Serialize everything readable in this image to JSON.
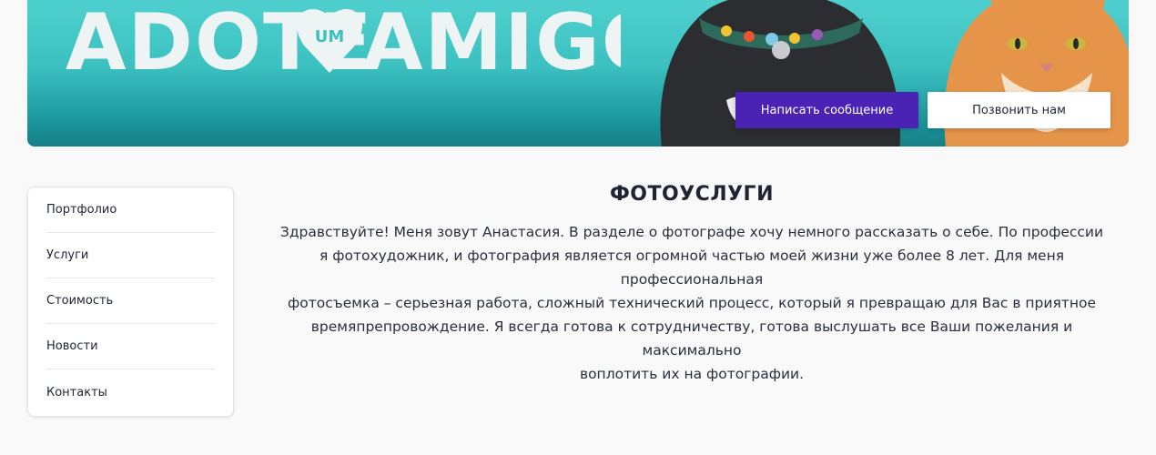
{
  "banner": {
    "logo_text_left": "ADOTE",
    "logo_text_badge": "UM",
    "logo_text_right": "AMIGO",
    "write_message_label": "Написать сообщение",
    "call_us_label": "Позвонить нам",
    "colors": {
      "accent": "#4a23b5",
      "banner": "#3cc0c0"
    }
  },
  "sidebar": {
    "items": [
      {
        "label": "Портфолио"
      },
      {
        "label": "Услуги"
      },
      {
        "label": "Стоимость"
      },
      {
        "label": "Новости"
      },
      {
        "label": "Контакты"
      }
    ]
  },
  "main": {
    "title": "ФОТОУСЛУГИ",
    "lines": [
      "Здравствуйте! Меня зовут Анастасия. В разделе о фотографе хочу немного рассказать о себе. По профессии",
      "я фотохудожник, и фотография является огромной частью моей жизни уже более 8 лет. Для меня профессиональная",
      "фотосъемка – серьезная работа, сложный технический процесс, который я превращаю для Вас в приятное",
      "времяпрепровождение. Я всегда готова к сотрудничеству, готова выслушать все Ваши пожелания и максимально",
      "воплотить их на фотографии."
    ]
  }
}
